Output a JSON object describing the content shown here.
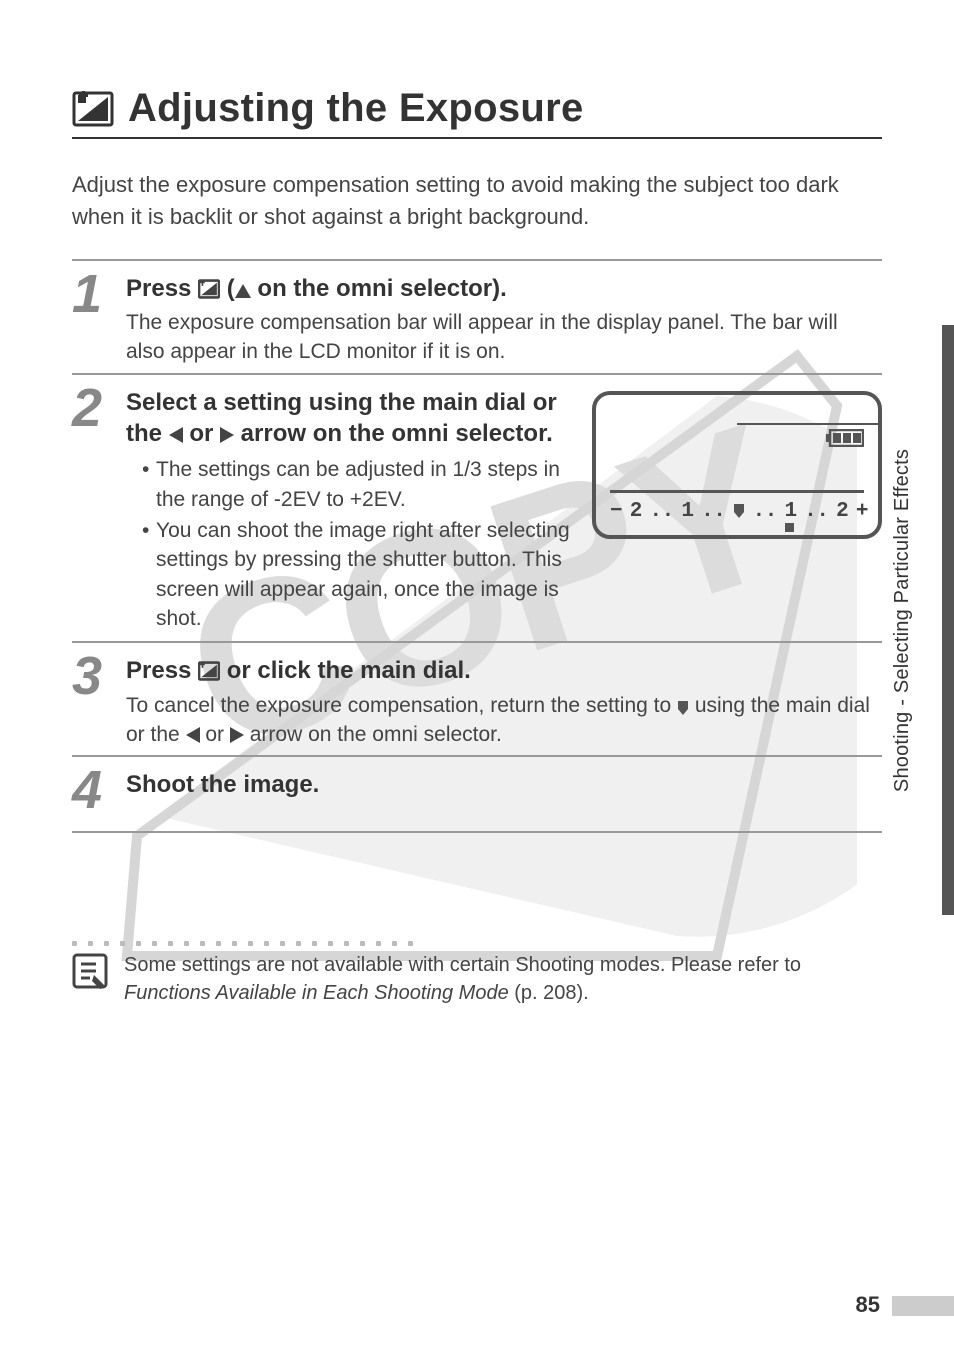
{
  "side_label": "Shooting - Selecting Particular Effects",
  "heading": "Adjusting the Exposure",
  "intro": "Adjust the exposure compensation setting to avoid making the subject too dark when it is backlit or shot against a bright background.",
  "steps": [
    {
      "num": "1",
      "title_prefix": "Press ",
      "title_mid": " (",
      "title_mid2": " on the omni selector).",
      "desc": "The exposure compensation bar will appear in the display panel. The bar will also appear in the LCD monitor if it is on."
    },
    {
      "num": "2",
      "title_line1": "Select a setting using the main dial or",
      "title_line2_prefix": "the ",
      "title_line2_mid": " or ",
      "title_line2_suffix": " arrow on the omni selector.",
      "bullet1": "The settings can be adjusted in 1/3 steps in the range of -2EV to +2EV.",
      "bullet2": "You can shoot the image right after selecting settings by pressing the shutter button. This screen will appear again, once the image is shot."
    },
    {
      "num": "3",
      "title_prefix": "Press ",
      "title_suffix": "  or click the main dial.",
      "desc_prefix": "To cancel the exposure compensation, return the setting to ",
      "desc_mid": " using the main dial or the ",
      "desc_mid2": " or ",
      "desc_suffix": " arrow on the omni selector."
    },
    {
      "num": "4",
      "title": "Shoot the image."
    }
  ],
  "panel": {
    "scale_minus": "−",
    "scale_plus": "+",
    "scale_2a": "2",
    "scale_1a": "1",
    "scale_1b": "1",
    "scale_2b": "2",
    "dots": ".."
  },
  "note_line1": "Some settings are not available with certain Shooting modes. Please refer to ",
  "note_em": "Functions Available in Each Shooting Mode",
  "note_line2": " (p. 208).",
  "page_number": "85"
}
